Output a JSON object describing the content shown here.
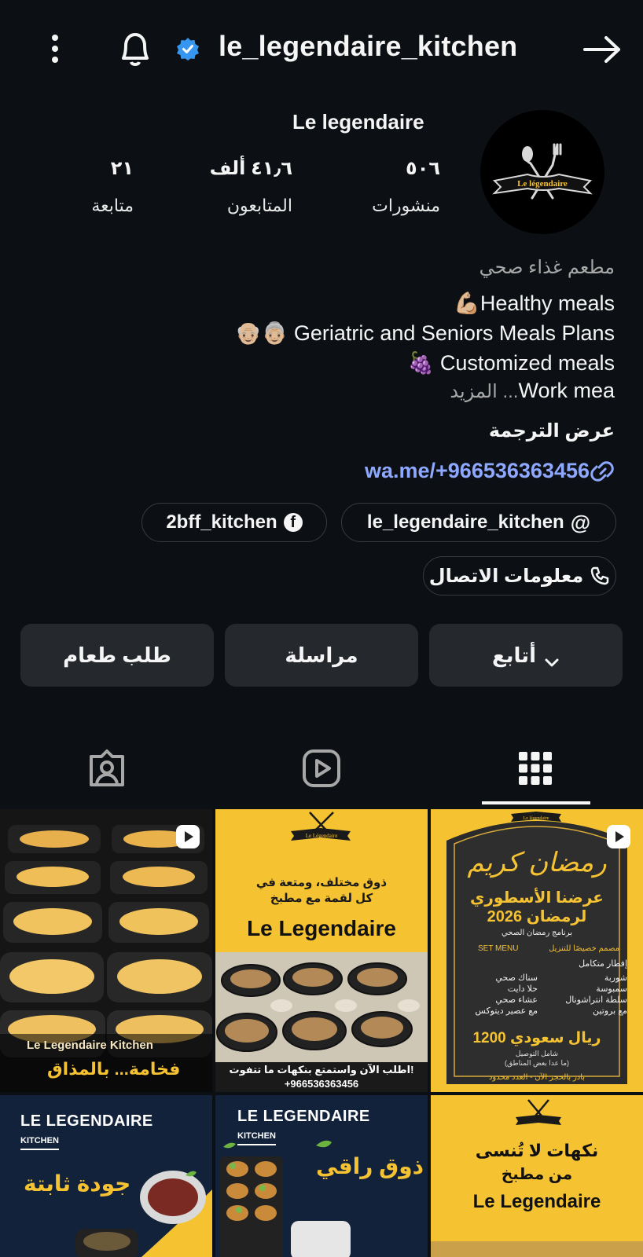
{
  "header": {
    "username": "le_legendaire_kitchen",
    "icons": [
      "more-icon",
      "bell-icon",
      "verified-badge-icon",
      "back-arrow-icon"
    ]
  },
  "profile": {
    "display_name": "Le legendaire",
    "avatar_text": "Le légendaire",
    "stats": [
      {
        "value": "٥٠٦",
        "label": "منشورات"
      },
      {
        "value": "٤١٫٦ ألف",
        "label": "المتابعون"
      },
      {
        "value": "٢١",
        "label": "متابعة"
      }
    ]
  },
  "bio": {
    "category": "مطعم غذاء صحي",
    "lines": [
      "💪🏼Healthy meals",
      "👴🏼👵🏼 Geriatric and Seniors Meals Plans",
      "🍇 Customized meals"
    ],
    "truncated_line": "Work mea",
    "more_label": "المزيد ...",
    "translate_label": "عرض الترجمة",
    "link": "wa.me/+966536363456"
  },
  "chips": {
    "threads": "le_legendaire_kitchen",
    "facebook": "2bff_kitchen",
    "contact": "معلومات الاتصال"
  },
  "actions": {
    "follow": "أتابع",
    "message": "مراسلة",
    "order": "طلب طعام"
  },
  "tabs": [
    "grid-icon",
    "reels-icon",
    "tagged-icon"
  ],
  "posts": {
    "p1": {
      "caption_en": "Le Legendaire Kitchen",
      "caption_ar": "فخامة... بالمذاق"
    },
    "p2": {
      "headline_ar_1": "ذوق مختلف، ومتعة في",
      "headline_ar_2": "كل لقمة مع مطبخ",
      "brand": "Le Legendaire",
      "footer_ar": "اطلب الآن واستمتع بنكهات ما تتفوت!",
      "phone": "+966536363456",
      "logo_text": "Le Légendaire"
    },
    "p3": {
      "logo_text": "Le légendaire",
      "script_title": "رمضان كريم",
      "offer_1": "عرضنا الأسطوري",
      "offer_2": "لرمضان 2026",
      "program": "برنامج رمضان الصحي",
      "set_menu": "SET MENU",
      "design_note": "مصمم خصيصًا للتنزيل",
      "col_right_title": "إفطار متكامل",
      "col_right_items": [
        "شوربة",
        "سمبوسة",
        "سلطة انتراشونال",
        "مع بروتين"
      ],
      "col_left_items": [
        "سناك صحي",
        "حلا دايت",
        "عشاء صحي",
        "مع عصير ديتوكس"
      ],
      "price": "1200 ريال سعودي",
      "price_note_1": "شامل التوصيل",
      "price_note_2": "(ما عدا بعض المناطق)",
      "footer": "بادر بالحجز الآن - العدد محدود"
    },
    "p4": {
      "brand": "LE LEGENDAIRE",
      "kitchen": "KITCHEN",
      "tagline": "جودة ثابتة"
    },
    "p5": {
      "brand": "LE LEGENDAIRE",
      "kitchen": "KITCHEN",
      "tagline": "ذوق راقي"
    },
    "p6": {
      "line1": "نكهات لا تُنسى",
      "line2": "من مطبخ",
      "brand": "Le Legendaire"
    }
  },
  "colors": {
    "background": "#0c1014",
    "button": "#25292e",
    "link": "#8fa8ff",
    "verified": "#3797f0",
    "brand_yellow": "#f5c232",
    "navy": "#12223a"
  }
}
